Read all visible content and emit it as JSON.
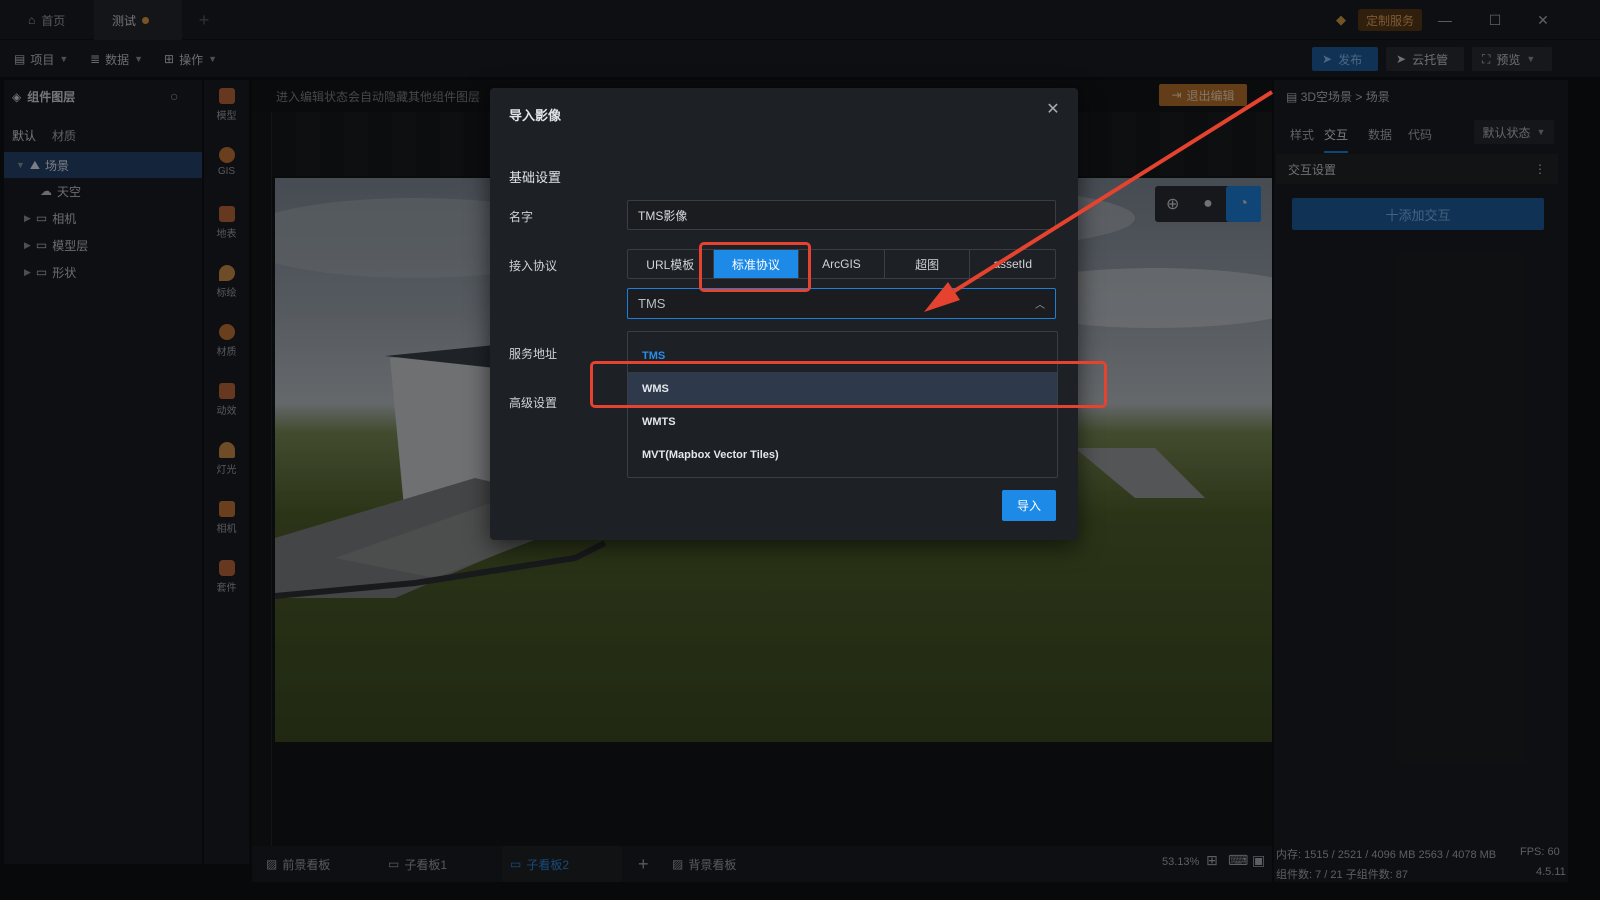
{
  "titlebar": {
    "tabs": [
      {
        "label": "首页",
        "icon": "home-icon"
      },
      {
        "label": "测试",
        "modified": true
      }
    ],
    "custom_service": "定制服务",
    "window_buttons": [
      "—",
      "☐",
      "✕"
    ]
  },
  "toolbar": {
    "menus": [
      "项目",
      "数据",
      "操作"
    ],
    "publish": "发布",
    "cloud_host": "云托管",
    "preview": "预览"
  },
  "left_panel": {
    "title": "组件图层",
    "tabs": [
      "默认",
      "材质"
    ],
    "tree": [
      {
        "label": "场景",
        "selected": true
      },
      {
        "label": "天空"
      },
      {
        "label": "相机"
      },
      {
        "label": "模型层"
      },
      {
        "label": "形状"
      }
    ]
  },
  "icon_bar": [
    "模型",
    "GIS",
    "地表",
    "标绘",
    "材质",
    "动效",
    "灯光",
    "相机",
    "套件"
  ],
  "canvas": {
    "hint": "进入编辑状态会自动隐藏其他组件图层",
    "exit_edit": "退出编辑"
  },
  "right_panel": {
    "breadcrumb": "3D空场景 > 场景",
    "tabs": [
      "样式",
      "交互",
      "数据",
      "代码"
    ],
    "default_state": "默认状态",
    "section_title": "交互设置",
    "add_interaction": "十添加交互"
  },
  "bottom_tabs": [
    "前景看板",
    "子看板1",
    "子看板2",
    "背景看板"
  ],
  "status": {
    "zoom": "53.13%",
    "memory": "内存: 1515 / 2521 / 4096 MB  2563 / 4078 MB",
    "fps": "FPS: 60",
    "components": "组件数: 7 / 21   子组件数: 87",
    "version": "4.5.11"
  },
  "modal": {
    "title": "导入影像",
    "section": "基础设置",
    "name_label": "名字",
    "name_value": "TMS影像",
    "protocol_label": "接入协议",
    "protocols": [
      "URL模板",
      "标准协议",
      "ArcGIS",
      "超图",
      "assetId"
    ],
    "protocol_selected": 1,
    "select_value": "TMS",
    "service_label": "服务地址",
    "advanced_label": "高级设置",
    "options": [
      "TMS",
      "WMS",
      "WMTS",
      "MVT(Mapbox Vector Tiles)"
    ],
    "import": "导入"
  },
  "colors": {
    "accent": "#1c8ae6",
    "annotation": "#e5432f",
    "warning": "#b2702d"
  }
}
